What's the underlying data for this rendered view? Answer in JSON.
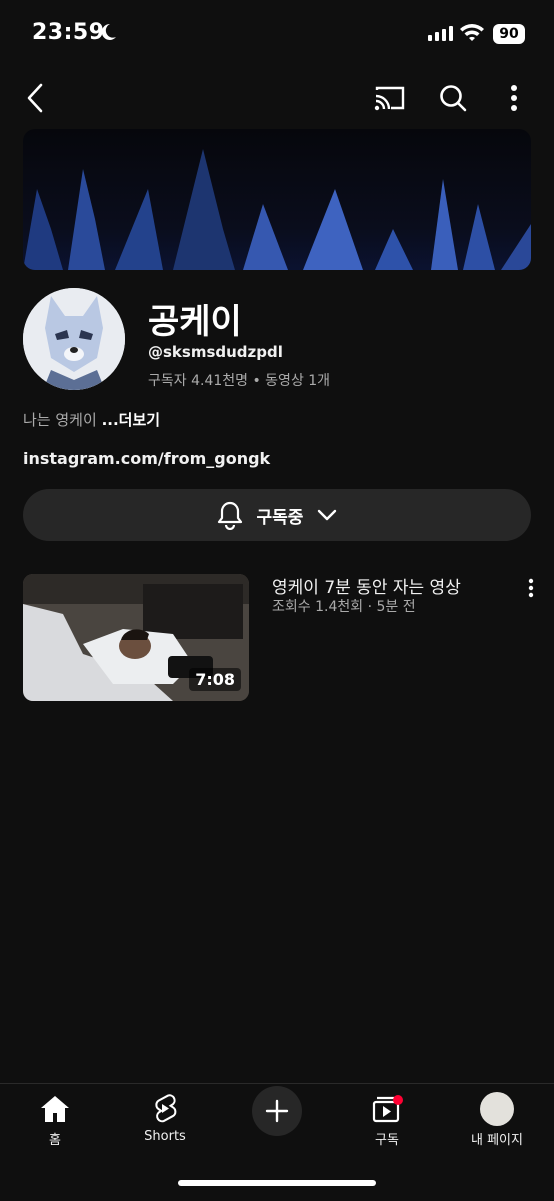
{
  "status_bar": {
    "time": "23:59",
    "battery": "90"
  },
  "channel": {
    "name": "공케이",
    "handle": "@sksmsdudzpdl",
    "stats": "구독자 4.41천명 • 동영상 1개",
    "description": "나는 영케이",
    "more_label": "...더보기",
    "link": "instagram.com/from_gongk",
    "subscribe_label": "구독중"
  },
  "videos": [
    {
      "title": "영케이 7분 동안 자는 영상",
      "meta": "조회수 1.4천회 · 5분 전",
      "duration": "7:08"
    }
  ],
  "bottom_nav": {
    "home": "홈",
    "shorts": "Shorts",
    "subscriptions": "구독",
    "my_page": "내 페이지"
  }
}
